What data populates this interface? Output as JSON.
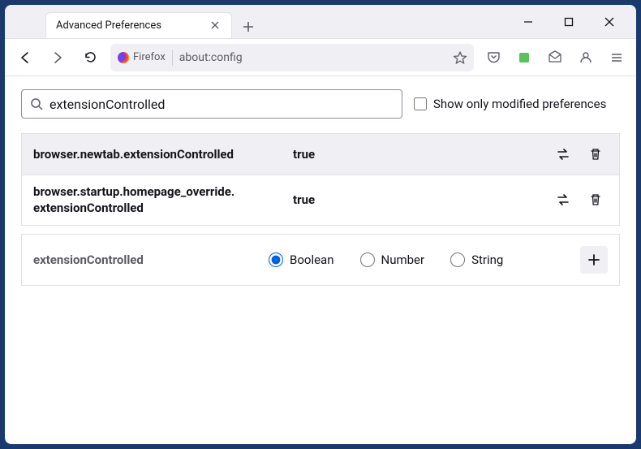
{
  "tab": {
    "title": "Advanced Preferences"
  },
  "urlbar": {
    "identity": "Firefox",
    "url": "about:config"
  },
  "search": {
    "value": "extensionControlled"
  },
  "checkbox": {
    "label": "Show only modified preferences"
  },
  "prefs": [
    {
      "name": "browser.newtab.extensionControlled",
      "value": "true"
    },
    {
      "name": "browser.startup.homepage_override. extensionControlled",
      "value": "true"
    }
  ],
  "create": {
    "name": "extensionControlled",
    "types": [
      "Boolean",
      "Number",
      "String"
    ]
  }
}
